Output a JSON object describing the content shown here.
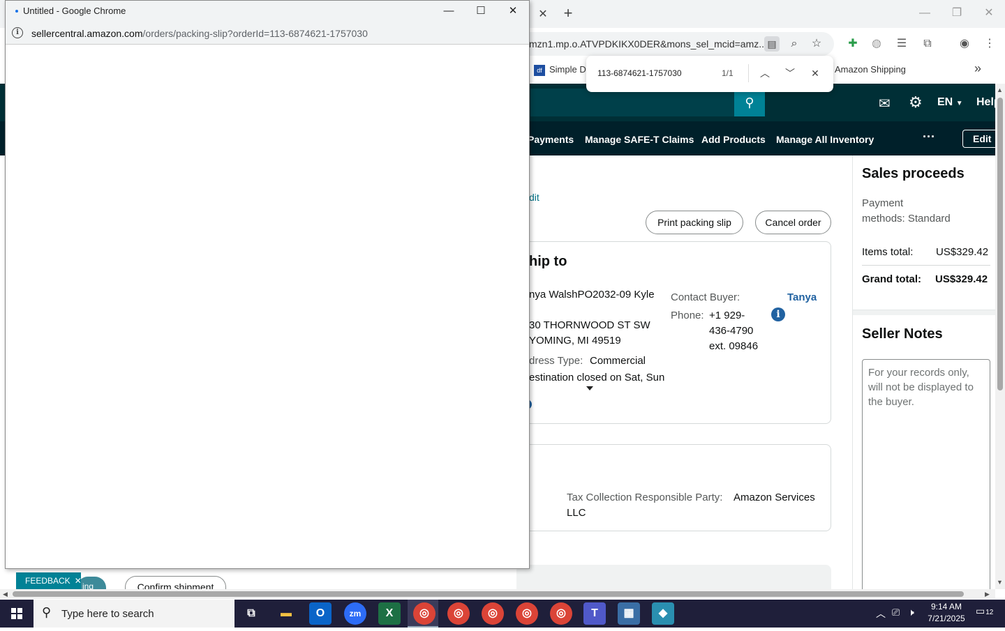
{
  "background_window": {
    "url_fragment": "mzn1.mp.o.ATVPDKIKX0DER&mons_sel_mcid=amz...",
    "bookmarks": {
      "simple": "Simple Da",
      "simple_icon": "df",
      "amazon_shipping": "Amazon Shipping",
      "more": "»"
    },
    "find_bar": {
      "query": "113-6874621-1757030",
      "count": "1/1"
    }
  },
  "amazon": {
    "header": {
      "lang": "EN",
      "help": "Help"
    },
    "nav": [
      "Payments",
      "Manage SAFE-T Claims",
      "Add Products",
      "Manage All Inventory"
    ],
    "nav_edit": "Edit",
    "edit_link": "dit",
    "buttons": {
      "print_packing_slip": "Print packing slip",
      "cancel_order": "Cancel order"
    },
    "ship_to": {
      "heading": "hip to",
      "name_line": "nya WalshPO2032-09 Kyle",
      "address_line1": "30 THORNWOOD ST SW",
      "address_line2": "YOMING, MI 49519",
      "address_type_label": "dress Type:",
      "address_type_value": "Commercial",
      "destination_note": "estination closed on Sat, Sun",
      "contact_label": "Contact Buyer:",
      "contact_name": "Tanya",
      "phone_label": "Phone:",
      "phone_line1": "+1 929-",
      "phone_line2": "436-4790",
      "phone_line3": "ext. 09846"
    },
    "tax": {
      "label": "Tax Collection Responsible Party:",
      "value_line1": "Amazon Services",
      "value_line2": "LLC"
    },
    "sidebar": {
      "sales_heading": "Sales proceeds",
      "payment_line1": "Payment",
      "payment_line2": "methods: Standard",
      "items_total_label": "Items total:",
      "items_total_value": "US$329.42",
      "grand_total_label": "Grand total:",
      "grand_total_value": "US$329.42",
      "notes_heading": "Seller Notes",
      "notes_placeholder": "For your records only, will not be displayed to the buyer."
    },
    "feedback": "FEEDBACK",
    "partial_button": "ing",
    "confirm_shipment": "Confirm shipment"
  },
  "popup": {
    "title": "Untitled - Google Chrome",
    "url_host": "sellercentral.amazon.com",
    "url_path": "/orders/packing-slip?orderId=113-6874621-1757030"
  },
  "taskbar": {
    "search_placeholder": "Type here to search",
    "time": "9:14 AM",
    "date": "7/21/2025",
    "notification_count": "12",
    "apps": [
      "task-view",
      "file-explorer",
      "outlook",
      "zoom",
      "excel",
      "chrome",
      "chrome",
      "chrome",
      "chrome",
      "chrome",
      "teams",
      "calculator",
      "app"
    ]
  }
}
